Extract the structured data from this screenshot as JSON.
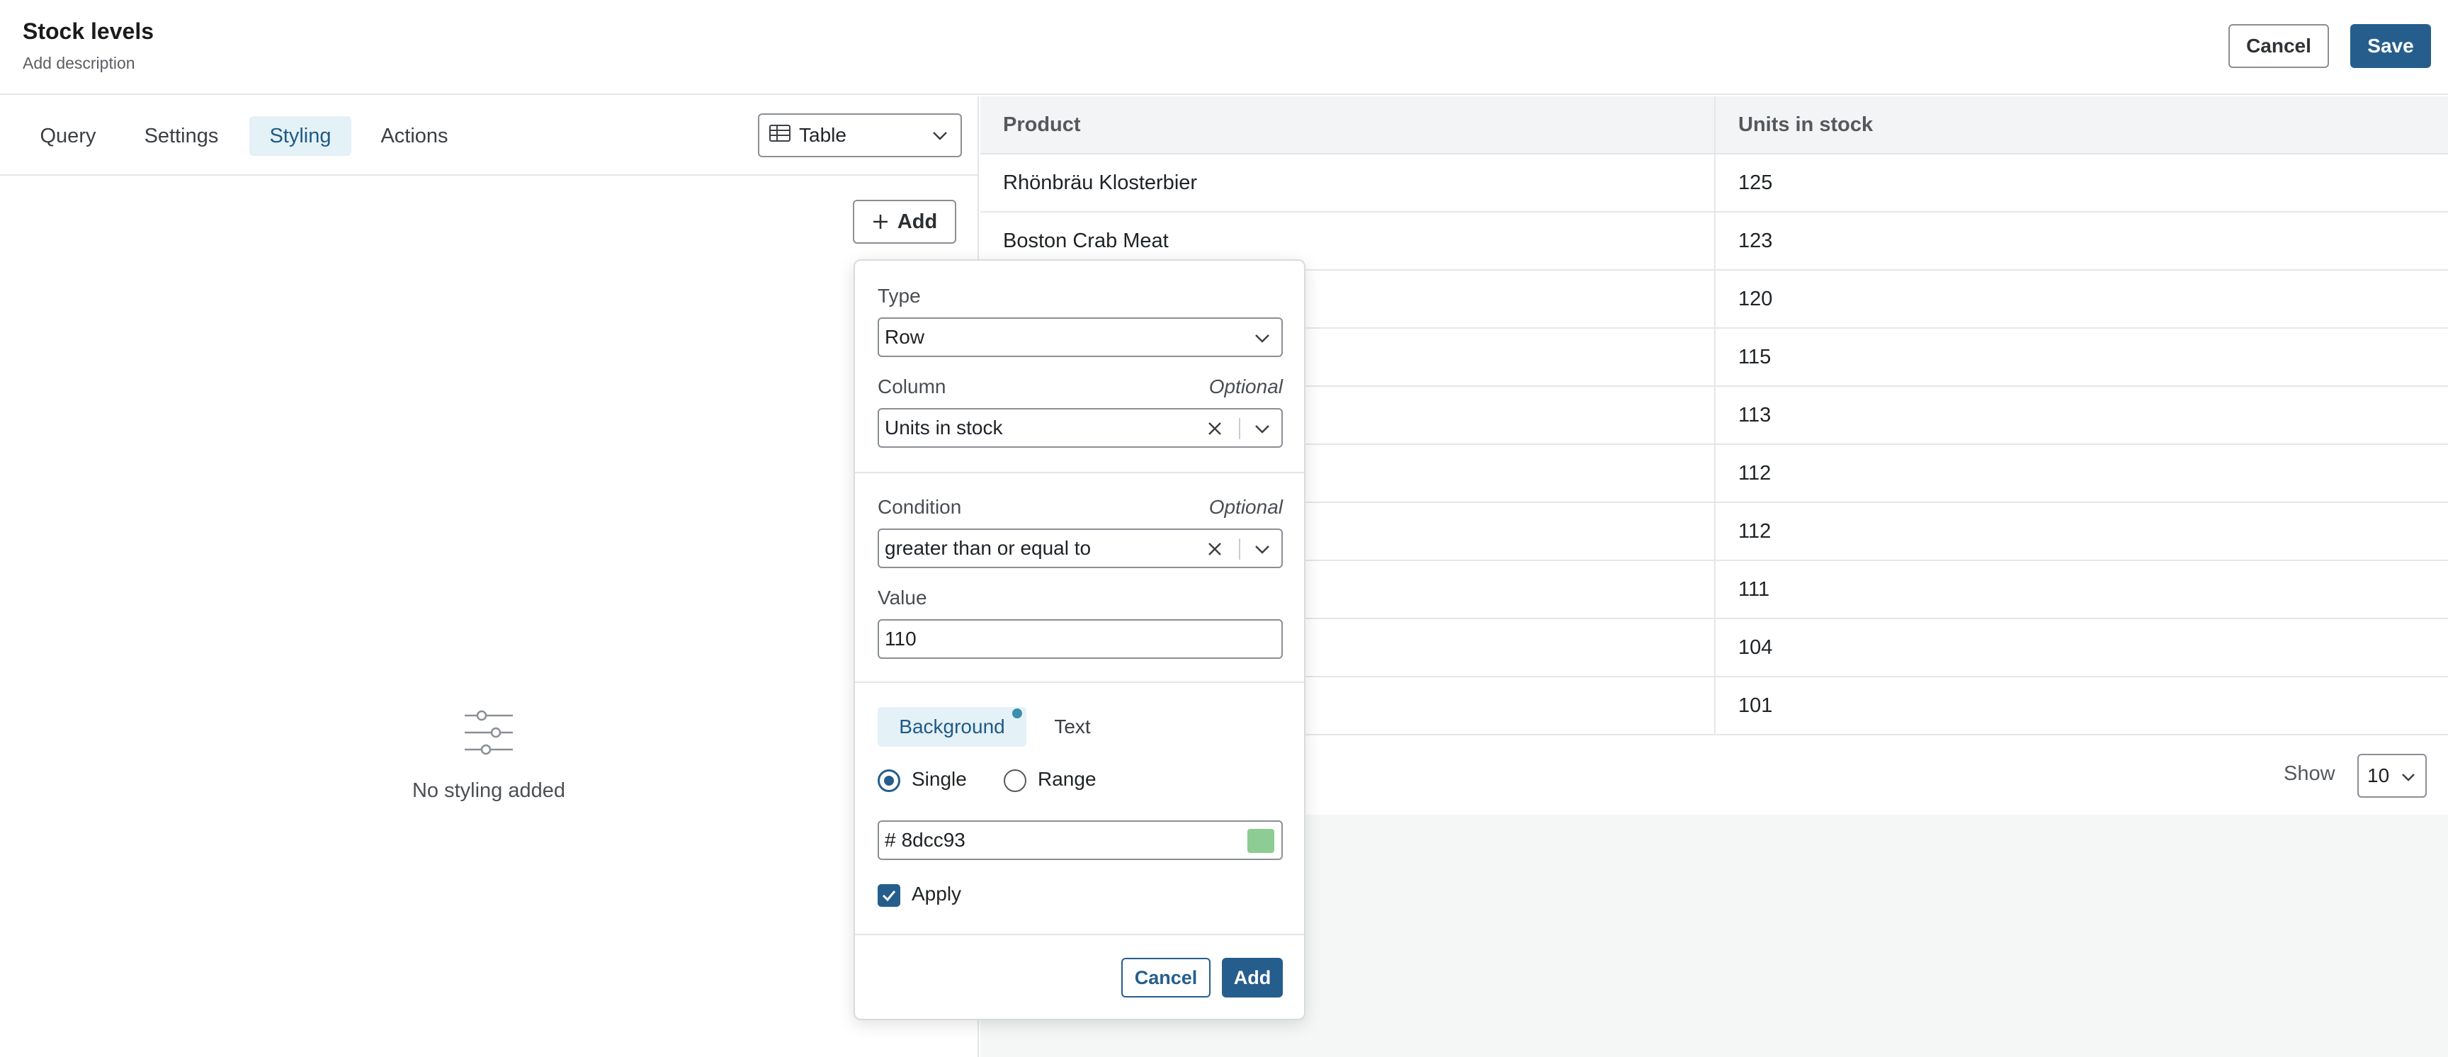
{
  "header": {
    "title": "Stock levels",
    "description": "Add description",
    "cancel_label": "Cancel",
    "save_label": "Save"
  },
  "left_panel": {
    "tabs": [
      {
        "label": "Query"
      },
      {
        "label": "Settings"
      },
      {
        "label": "Styling",
        "active": true
      },
      {
        "label": "Actions"
      }
    ],
    "viz_select": {
      "value": "Table",
      "icon": "table-icon"
    },
    "add_label": "Add",
    "empty_state": {
      "text": "No styling added",
      "icon": "sliders-icon"
    }
  },
  "table": {
    "columns": [
      "Product",
      "Units in stock"
    ],
    "rows": [
      [
        "Rhönbräu Klosterbier",
        "125"
      ],
      [
        "Boston Crab Meat",
        "123"
      ],
      [
        "",
        "120"
      ],
      [
        "",
        "115"
      ],
      [
        "",
        "113"
      ],
      [
        "",
        "112"
      ],
      [
        "",
        "112"
      ],
      [
        "",
        "111"
      ],
      [
        "",
        "104"
      ],
      [
        "",
        "101"
      ]
    ],
    "show_label": "Show",
    "page_size": "10"
  },
  "popover": {
    "type_label": "Type",
    "type_value": "Row",
    "column_label": "Column",
    "column_optional": "Optional",
    "column_value": "Units in stock",
    "condition_label": "Condition",
    "condition_optional": "Optional",
    "condition_value": "greater than or equal to",
    "value_label": "Value",
    "value_value": "110",
    "color_tabs": {
      "background": "Background",
      "text": "Text"
    },
    "mode": {
      "single": "Single",
      "range": "Range",
      "selected": "single"
    },
    "color_prefix": "#",
    "color_value": "8dcc93",
    "apply_label": "Apply",
    "apply_checked": true,
    "cancel_label": "Cancel",
    "add_label": "Add"
  },
  "colors": {
    "primary": "#255e8c",
    "active_tab_bg": "#e4f1f7",
    "swatch": "#8dcc93"
  }
}
